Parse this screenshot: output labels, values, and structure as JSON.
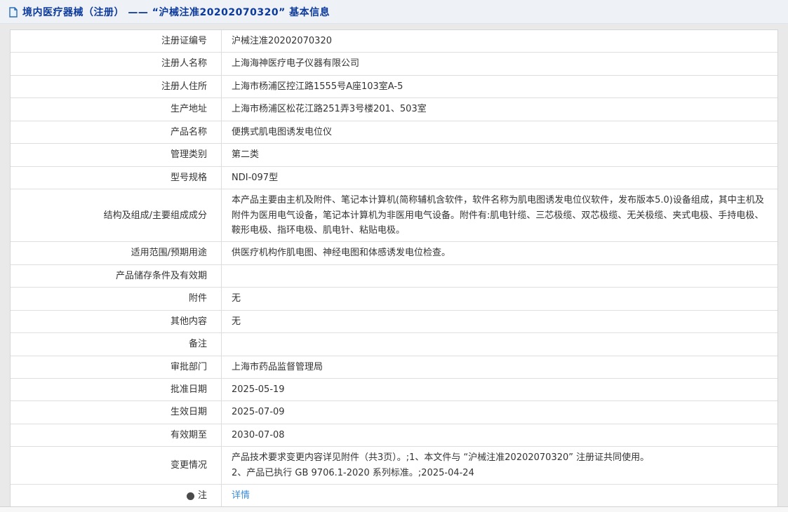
{
  "header": {
    "icon": "document-icon",
    "title": "境内医疗器械（注册） —— “沪械注准20202070320” 基本信息"
  },
  "colors": {
    "title_blue": "#0b3a9b",
    "link_blue": "#3a8bd8",
    "border": "#dedede",
    "page_bg": "#e9e9e9"
  },
  "table": {
    "rows": [
      {
        "label": "注册证编号",
        "value": "沪械注准20202070320"
      },
      {
        "label": "注册人名称",
        "value": "上海海神医疗电子仪器有限公司"
      },
      {
        "label": "注册人住所",
        "value": "上海市杨浦区控江路1555号A座103室A-5"
      },
      {
        "label": "生产地址",
        "value": "上海市杨浦区松花江路251弄3号楼201、503室"
      },
      {
        "label": "产品名称",
        "value": "便携式肌电图诱发电位仪"
      },
      {
        "label": "管理类别",
        "value": "第二类"
      },
      {
        "label": "型号规格",
        "value": "NDI-097型"
      },
      {
        "label": "结构及组成/主要组成成分",
        "value": "本产品主要由主机及附件、笔记本计算机(简称辅机含软件，软件名称为肌电图诱发电位仪软件，发布版本5.0)设备组成，其中主机及附件为医用电气设备，笔记本计算机为非医用电气设备。附件有:肌电针缆、三芯极缆、双芯极缆、无关极缆、夹式电极、手持电极、鞍形电极、指环电极、肌电针、粘贴电极。"
      },
      {
        "label": "适用范围/预期用途",
        "value": "供医疗机构作肌电图、神经电图和体感诱发电位检查。"
      },
      {
        "label": "产品储存条件及有效期",
        "value": ""
      },
      {
        "label": "附件",
        "value": "无"
      },
      {
        "label": "其他内容",
        "value": "无"
      },
      {
        "label": "备注",
        "value": ""
      },
      {
        "label": "审批部门",
        "value": "上海市药品监督管理局"
      },
      {
        "label": "批准日期",
        "value": "2025-05-19"
      },
      {
        "label": "生效日期",
        "value": "2025-07-09"
      },
      {
        "label": "有效期至",
        "value": "2030-07-08"
      },
      {
        "label": "变更情况",
        "value": "产品技术要求变更内容详见附件（共3页）。;1、本文件与 “沪械注准20202070320” 注册证共同使用。\n2、产品已执行 GB 9706.1-2020 系列标准。;2025-04-24"
      },
      {
        "label": "注",
        "label_icon": "note-icon",
        "value": "详情",
        "value_is_link": true
      }
    ]
  }
}
